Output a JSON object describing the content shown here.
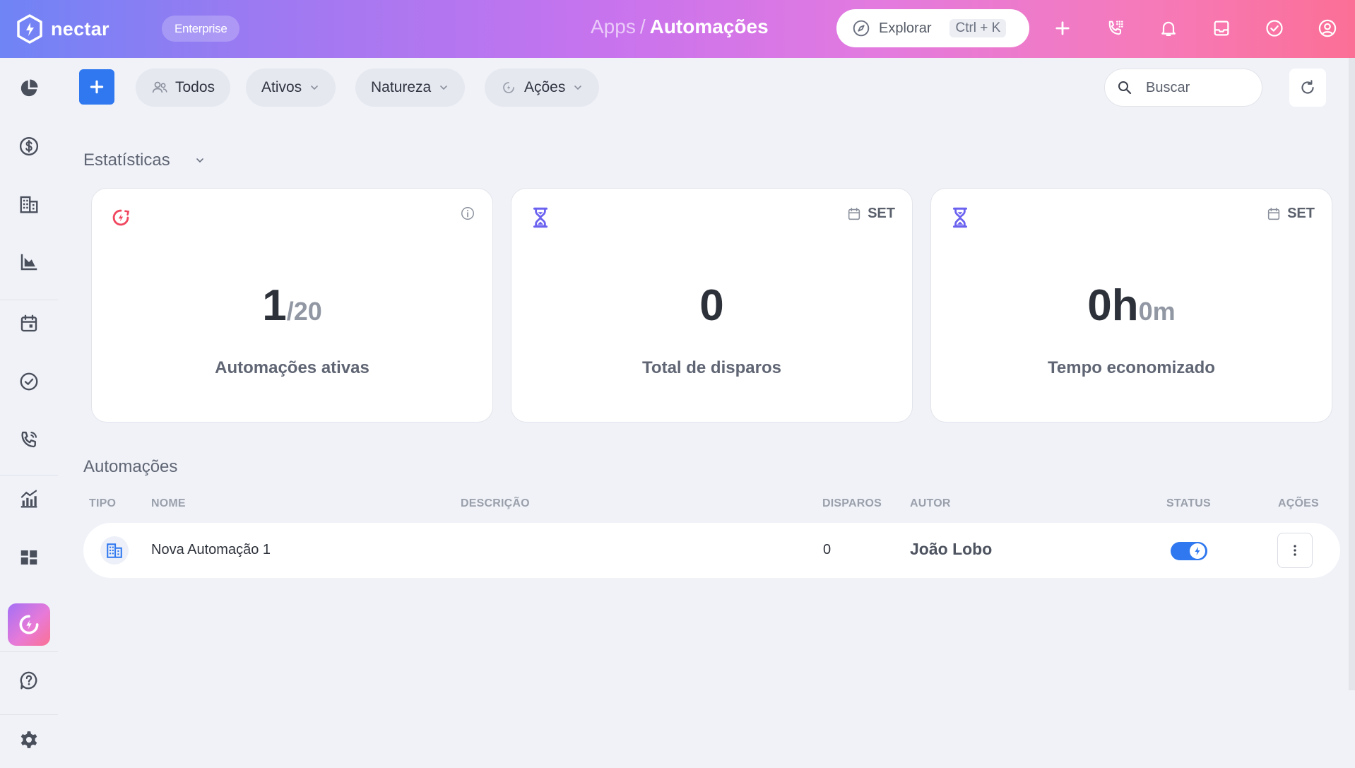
{
  "app": {
    "brand": "nectar",
    "plan_badge": "Enterprise"
  },
  "breadcrumb": {
    "parent": "Apps",
    "separator": "/",
    "current": "Automações"
  },
  "explore": {
    "label": "Explorar",
    "shortcut": "Ctrl + K"
  },
  "top_icons": [
    "plus-icon",
    "phone-dialpad-icon",
    "bell-icon",
    "inbox-icon",
    "check-circle-icon",
    "user-circle-icon"
  ],
  "sidebar": {
    "items": [
      "pie-chart-icon",
      "dollar-icon",
      "building-icon",
      "funnel-chart-icon",
      "calendar-icon",
      "check-circle-icon",
      "phone-icon",
      "bar-chart-icon",
      "dashboard-icon",
      "automation-icon",
      "help-icon",
      "settings-icon"
    ],
    "active": "automation-icon"
  },
  "toolbar": {
    "filters": [
      {
        "label": "Todos",
        "icon": "users-icon"
      },
      {
        "label": "Ativos"
      },
      {
        "label": "Natureza"
      },
      {
        "label": "Ações",
        "icon": "automation-icon"
      }
    ],
    "search_placeholder": "Buscar"
  },
  "stats": {
    "title": "Estatísticas",
    "cards": [
      {
        "value": "1",
        "suffix": "/20",
        "label": "Automações ativas",
        "icon": "automation-icon",
        "corner": ""
      },
      {
        "value": "0",
        "suffix": "",
        "label": "Total de disparos",
        "icon": "hourglass-icon",
        "corner": "SET"
      },
      {
        "value": "0h",
        "suffix": "0m",
        "label": "Tempo economizado",
        "icon": "hourglass-icon",
        "corner": "SET"
      }
    ]
  },
  "automations": {
    "title": "Automações",
    "columns": [
      "TIPO",
      "NOME",
      "DESCRIÇÃO",
      "DISPAROS",
      "AUTOR",
      "STATUS",
      "AÇÕES"
    ],
    "rows": [
      {
        "type_icon": "building-icon",
        "name": "Nova Automação 1",
        "description": "",
        "triggers": "0",
        "author": "João Lobo",
        "status": true
      }
    ]
  },
  "colors": {
    "primary": "#2f78ef",
    "automation": "#f0475f",
    "hourglass": "#6b63f0"
  }
}
